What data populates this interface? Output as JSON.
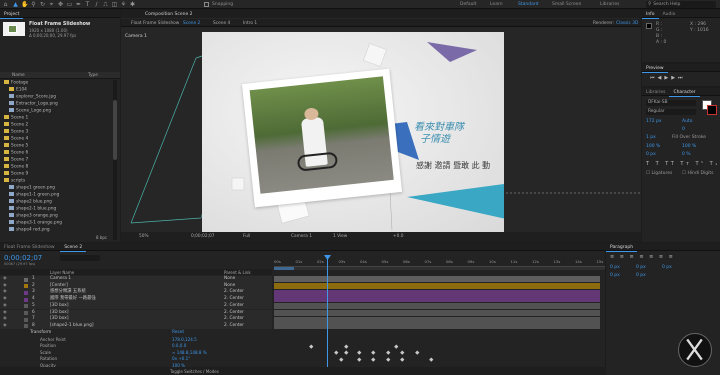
{
  "topbar": {
    "workspaces": [
      "Default",
      "Learn",
      "Standard",
      "Small Screen",
      "Libraries"
    ],
    "active_workspace": "Standard",
    "snapping": "Snapping",
    "search_placeholder": "Search Help"
  },
  "project": {
    "title": "Project",
    "comp_name": "Float Frame Slideshow",
    "comp_info1": "1920 x 1080 (1.00)",
    "comp_info2": "Δ 0;00;20;00, 29.97 fps",
    "name_header": "Name",
    "type_header": "Type",
    "items": [
      {
        "name": "Footage",
        "indent": 0,
        "kind": "folder"
      },
      {
        "name": "E104",
        "indent": 1,
        "kind": "folder"
      },
      {
        "name": "explorer_Score.jpg",
        "indent": 1,
        "kind": "file"
      },
      {
        "name": "Extractor_Logo.png",
        "indent": 1,
        "kind": "file"
      },
      {
        "name": "Scene_Logo.png",
        "indent": 1,
        "kind": "file"
      },
      {
        "name": "Scene 1",
        "indent": 0,
        "kind": "folder"
      },
      {
        "name": "Scene 2",
        "indent": 0,
        "kind": "folder"
      },
      {
        "name": "Scene 3",
        "indent": 0,
        "kind": "folder"
      },
      {
        "name": "Scene 4",
        "indent": 0,
        "kind": "folder"
      },
      {
        "name": "Scene 5",
        "indent": 0,
        "kind": "folder"
      },
      {
        "name": "Scene 6",
        "indent": 0,
        "kind": "folder"
      },
      {
        "name": "Scene 7",
        "indent": 0,
        "kind": "folder"
      },
      {
        "name": "Scene 8",
        "indent": 0,
        "kind": "folder"
      },
      {
        "name": "Scene 9",
        "indent": 0,
        "kind": "folder"
      },
      {
        "name": "scripts",
        "indent": 0,
        "kind": "folder"
      },
      {
        "name": "shape1 green.png",
        "indent": 1,
        "kind": "file"
      },
      {
        "name": "shape1-1 green.png",
        "indent": 1,
        "kind": "file"
      },
      {
        "name": "shape2 blue.png",
        "indent": 1,
        "kind": "file"
      },
      {
        "name": "shape2-1 blue.png",
        "indent": 1,
        "kind": "file"
      },
      {
        "name": "shape3 orange.png",
        "indent": 1,
        "kind": "file"
      },
      {
        "name": "shape3-1 orange.png",
        "indent": 1,
        "kind": "file"
      },
      {
        "name": "shape4 red.png",
        "indent": 1,
        "kind": "file"
      }
    ],
    "bpc": "8 bpc"
  },
  "composition": {
    "panel_title": "Composition Scene 2",
    "tabs": [
      "Float Frame Slideshow",
      "Scene 2",
      "Scene 4",
      "Intro 1"
    ],
    "active_tab": "Scene 2",
    "renderer": "Renderer:",
    "renderer_value": "Classic 3D",
    "camera_label": "Camera 1",
    "zoom": "50%",
    "timecode": "0;00;02;07",
    "resolution": "Full",
    "view_camera": "Camera 1",
    "views": "1 View",
    "exposure": "+0.0"
  },
  "slide": {
    "title_line1": "看來對車隊",
    "title_line2": "子情遊",
    "tag_line": "感謝 邀請 暨敢  此 動"
  },
  "info": {
    "tabs": [
      "Info",
      "Audio"
    ],
    "r": "R :",
    "g": "G :",
    "b": "B :",
    "a": "A : 0",
    "x": "X : 296",
    "y": "Y : 1016"
  },
  "preview": {
    "title": "Preview"
  },
  "character": {
    "tabs": [
      "Libraries",
      "Character"
    ],
    "font": "DFKai-SB",
    "style": "Regular",
    "size": "172 px",
    "leading": "Auto",
    "tracking": "0",
    "stroke_width": "1 px",
    "stroke_mode": "Fill Over Stroke",
    "vscale": "100 %",
    "hscale": "100 %",
    "baseline": "0 px",
    "tsume": "0 %",
    "ligatures": "Ligatures",
    "hindi_digits": "Hindi Digits"
  },
  "paragraph": {
    "title": "Paragraph",
    "fields": [
      "0 px",
      "0 px",
      "0 px",
      "0 px",
      "0 px"
    ]
  },
  "timeline": {
    "tabs": [
      "Float Frame Slideshow",
      "Scene 2"
    ],
    "current_time": "0;00;02;07",
    "time_sub": "00067 (29.97 fps)",
    "header_name": "Layer Name",
    "header_parent": "Parent & Link",
    "ruler": [
      "00s",
      "01s",
      "02s",
      "03s",
      "04s",
      "05s",
      "06s",
      "07s",
      "08s",
      "09s",
      "10s",
      "11s",
      "12s",
      "13s",
      "14s",
      "15s"
    ],
    "layers": [
      {
        "num": "1",
        "name": "Camera 1",
        "parent": "None",
        "color": "#6a6a6a"
      },
      {
        "num": "2",
        "name": "[Center]",
        "parent": "None",
        "color": "#a0780c"
      },
      {
        "num": "3",
        "name": "感想分類讀 五系統",
        "parent": "2. Center",
        "color": "#6e3a85"
      },
      {
        "num": "4",
        "name": "國際 我帶最好 一路最強",
        "parent": "2. Center",
        "color": "#6e3a85"
      },
      {
        "num": "5",
        "name": "[3D box]",
        "parent": "2. Center",
        "color": "#5a5a5a"
      },
      {
        "num": "6",
        "name": "[3D box]",
        "parent": "2. Center",
        "color": "#5a5a5a"
      },
      {
        "num": "7",
        "name": "[3D box]",
        "parent": "2. Center",
        "color": "#5a5a5a"
      },
      {
        "num": "8",
        "name": "[shape2-1 blue.png]",
        "parent": "2. Center",
        "color": "#5a5a5a"
      }
    ],
    "transform_label": "Transform",
    "reset": "Reset",
    "props": [
      {
        "name": "Anchor Point",
        "value": "178.0,124.5"
      },
      {
        "name": "Position",
        "value": "0.0,0.0"
      },
      {
        "name": "Scale",
        "value": "∞ 148.8,148.8 %"
      },
      {
        "name": "Rotation",
        "value": "0x +6.1°"
      },
      {
        "name": "Opacity",
        "value": "100 %"
      }
    ],
    "footer": "Toggle Switches / Modes"
  }
}
